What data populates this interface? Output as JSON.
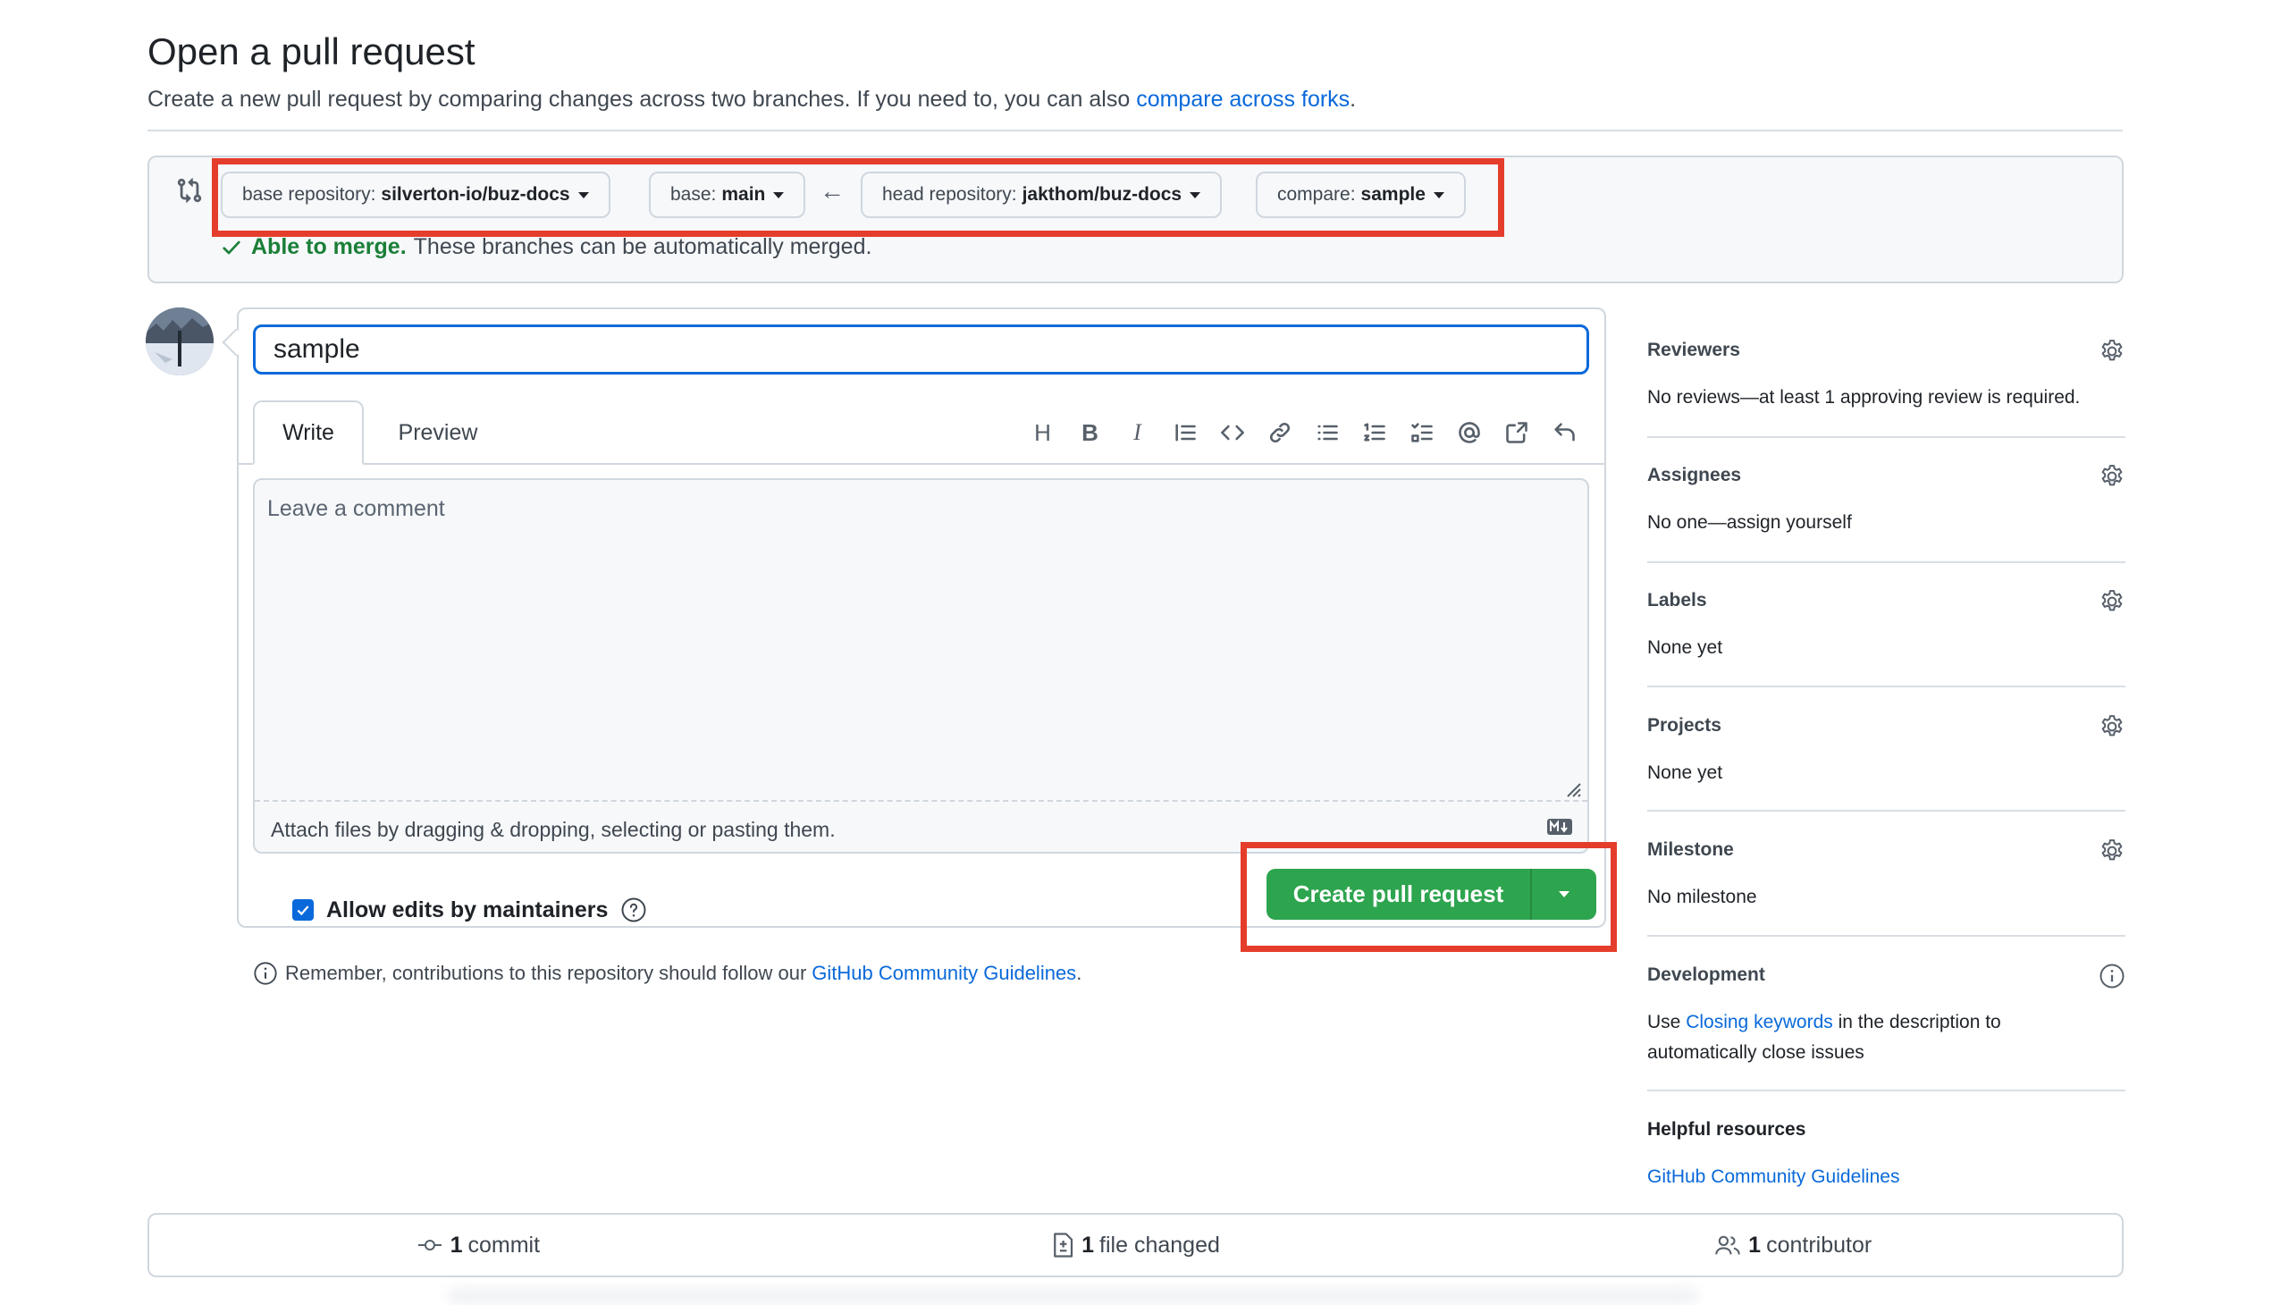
{
  "header": {
    "title": "Open a pull request",
    "subtitle_prefix": "Create a new pull request by comparing changes across two branches. If you need to, you can also",
    "subtitle_link": "compare across forks",
    "subtitle_suffix": "."
  },
  "range": {
    "base_repo_label": "base repository:",
    "base_repo_value": "silverton-io/buz-docs",
    "base_label": "base:",
    "base_value": "main",
    "head_repo_label": "head repository:",
    "head_repo_value": "jakthom/buz-docs",
    "compare_label": "compare:",
    "compare_value": "sample",
    "merge_ok": "Able to merge.",
    "merge_text": "These branches can be automatically merged."
  },
  "form": {
    "title_value": "sample",
    "tab_write": "Write",
    "tab_preview": "Preview",
    "comment_placeholder": "Leave a comment",
    "attach_text": "Attach files by dragging & dropping, selecting or pasting them.",
    "allow_edits_label": "Allow edits by maintainers",
    "allow_edits_checked": true,
    "create_button": "Create pull request",
    "toolbar_icons": [
      "heading-icon",
      "bold-icon",
      "italic-icon",
      "quote-icon",
      "code-icon",
      "link-icon",
      "unordered-list-icon",
      "ordered-list-icon",
      "task-list-icon",
      "mention-icon",
      "reference-icon",
      "undo-icon"
    ]
  },
  "reminder": {
    "text": "Remember, contributions to this repository should follow our",
    "link": "GitHub Community Guidelines",
    "suffix": "."
  },
  "sidebar": {
    "reviewers": {
      "heading": "Reviewers",
      "body": "No reviews—at least 1 approving review is required."
    },
    "assignees": {
      "heading": "Assignees",
      "body": "No one—assign yourself"
    },
    "labels": {
      "heading": "Labels",
      "body": "None yet"
    },
    "projects": {
      "heading": "Projects",
      "body": "None yet"
    },
    "milestone": {
      "heading": "Milestone",
      "body": "No milestone"
    },
    "development": {
      "heading": "Development",
      "body_prefix": "Use",
      "body_link": "Closing keywords",
      "body_suffix": "in the description to",
      "body_line2": "automatically close issues"
    },
    "helpful": {
      "heading": "Helpful resources",
      "link": "GitHub Community Guidelines"
    }
  },
  "stats": {
    "commits_count": "1",
    "commits_label": "commit",
    "files_count": "1",
    "files_label": "file changed",
    "contributors_count": "1",
    "contributors_label": "contributor"
  },
  "colors": {
    "accent": "#0969da",
    "success": "#2da44e",
    "highlight": "#e53d2c"
  }
}
